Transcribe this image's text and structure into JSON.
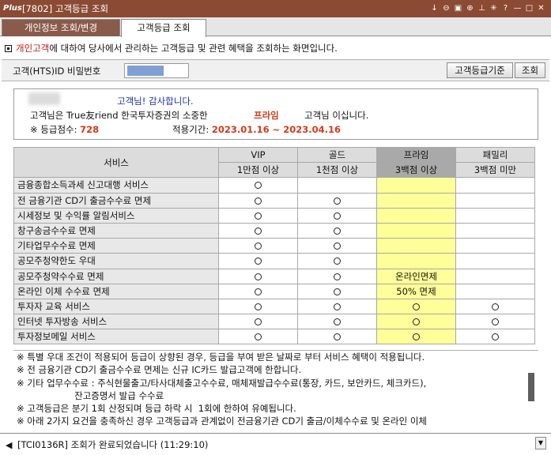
{
  "window": {
    "logo": "Plus",
    "title": "[7802] 고객등급 조회",
    "icons": [
      "down-arrow-icon",
      "zoom-out-icon",
      "resize-icon",
      "zoom-in-icon",
      "pin-icon",
      "settings-icon",
      "help-icon",
      "minimize-icon",
      "maximize-icon",
      "close-icon"
    ],
    "icon_glyphs": [
      "↓",
      "⊖",
      "▣",
      "⊕",
      "⊥",
      "✳",
      "?",
      "—",
      "□",
      "✕"
    ]
  },
  "tabs": [
    {
      "label": "개인정보 조회/변경",
      "active": false
    },
    {
      "label": "고객등급 조회",
      "active": true
    }
  ],
  "description": {
    "highlight": "개인고객",
    "rest": "에 대하여 당사에서 관리하는 고객등급 및 관련 혜택을 조회하는 화면입니다."
  },
  "id_row": {
    "label": "고객(HTS)ID 비밀번호",
    "grade_button": "고객등급기준",
    "search_button": "조회"
  },
  "greeting": {
    "line1": "고객님! 감사합니다.",
    "line2_prefix": "고객님은 True友riend 한국투자증권의 소중한",
    "tier": "프라임",
    "line2_suffix": "고객님 이십니다.",
    "score_label": "※ 등급점수:",
    "score": "728",
    "period_label": "적용기간:",
    "period": "2023.01.16 ~ 2023.04.16"
  },
  "table": {
    "service_header": "서비스",
    "grades": [
      {
        "name": "VIP",
        "criteria": "1만점 이상"
      },
      {
        "name": "골드",
        "criteria": "1천점 이상"
      },
      {
        "name": "프라임",
        "criteria": "3백점 이상"
      },
      {
        "name": "패밀리",
        "criteria": "3백점 미만"
      }
    ],
    "rows": [
      {
        "service": "금융종합소득과세 신고대행 서비스",
        "vip": "o",
        "gold": "",
        "prime": "",
        "family": ""
      },
      {
        "service": "전 금융기관 CD기 출금수수료 면제",
        "vip": "o",
        "gold": "o",
        "prime": "",
        "family": ""
      },
      {
        "service": "시세정보 및 수익률 알림서비스",
        "vip": "o",
        "gold": "o",
        "prime": "",
        "family": ""
      },
      {
        "service": "창구송금수수료 면제",
        "vip": "o",
        "gold": "o",
        "prime": "",
        "family": ""
      },
      {
        "service": "기타업무수수료 면제",
        "vip": "o",
        "gold": "o",
        "prime": "",
        "family": ""
      },
      {
        "service": "공모주청약한도 우대",
        "vip": "o",
        "gold": "o",
        "prime": "",
        "family": ""
      },
      {
        "service": "공모주청약수수료 면제",
        "vip": "o",
        "gold": "o",
        "prime": "온라인면제",
        "family": ""
      },
      {
        "service": "온라인 이체 수수료 면제",
        "vip": "o",
        "gold": "o",
        "prime": "50% 면제",
        "family": ""
      },
      {
        "service": "투자자 교육 서비스",
        "vip": "o",
        "gold": "o",
        "prime": "o",
        "family": "o"
      },
      {
        "service": "인터넷 투자방송 서비스",
        "vip": "o",
        "gold": "o",
        "prime": "o",
        "family": "o"
      },
      {
        "service": "투자정보메일 서비스",
        "vip": "o",
        "gold": "o",
        "prime": "o",
        "family": "o"
      }
    ]
  },
  "notes": [
    "※ 특별 우대 조건이 적용되어 등급이 상향된 경우, 등급을 부여 받은 날짜로 부터 서비스 혜택이 적용됩니다.",
    "※ 전 금융기관 CD기 출금수수료 면제는 신규 IC카드 발급고객에 한합니다.",
    "※ 기타 업무수수료 : 주식현물출고/타사대체출고수수료, 매체재발급수수료(통장, 카드, 보안카드, 체크카드),",
    "                    잔고증명서 발급 수수료",
    "※ 고객등급은 분기 1회 산정되며 등급 하락 시  1회에 한하여 유예됩니다.",
    "※ 아래 2가지 요건을 충족하신 경우 고객등급과 관계없이 전금융기관 CD기 출금/이체수수료 및 온라인 이체"
  ],
  "status": {
    "message": "[TCI0136R] 조회가 완료되었습니다 (11:29:10)"
  }
}
